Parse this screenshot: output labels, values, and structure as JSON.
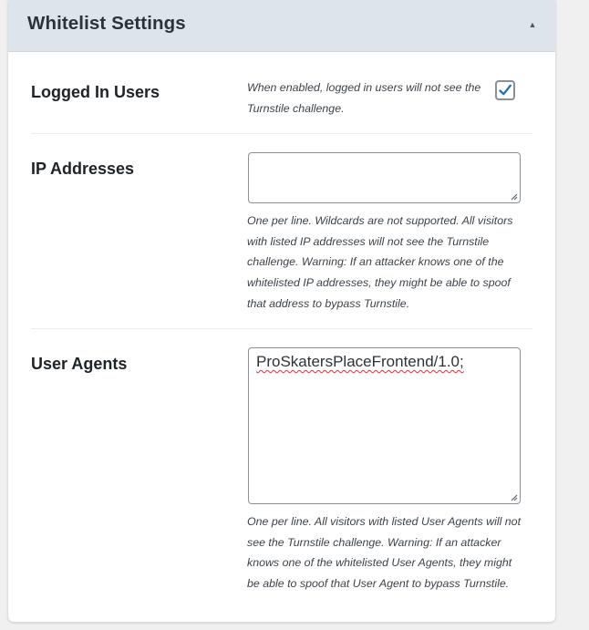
{
  "panel": {
    "title": "Whitelist Settings",
    "collapse_icon": "triangle-up-icon"
  },
  "logged_in_users": {
    "label": "Logged In Users",
    "description": "When enabled, logged in users will not see the Turnstile challenge.",
    "checked": true
  },
  "ip_addresses": {
    "label": "IP Addresses",
    "value": "",
    "description": "One per line. Wildcards are not supported. All visitors with listed IP addresses will not see the Turnstile challenge. Warning: If an attacker knows one of the whitelisted IP addresses, they might be able to spoof that address to bypass Turnstile."
  },
  "user_agents": {
    "label": "User Agents",
    "value": "ProSkatersPlaceFrontend/1.0;",
    "description": "One per line. All visitors with listed User Agents will not see the Turnstile challenge. Warning: If an attacker knows one of the whitelisted User Agents, they might be able to spoof that User Agent to bypass Turnstile."
  },
  "colors": {
    "header_bg": "#dde4ec",
    "checkmark": "#2271b1",
    "spellcheck": "#d63638"
  }
}
